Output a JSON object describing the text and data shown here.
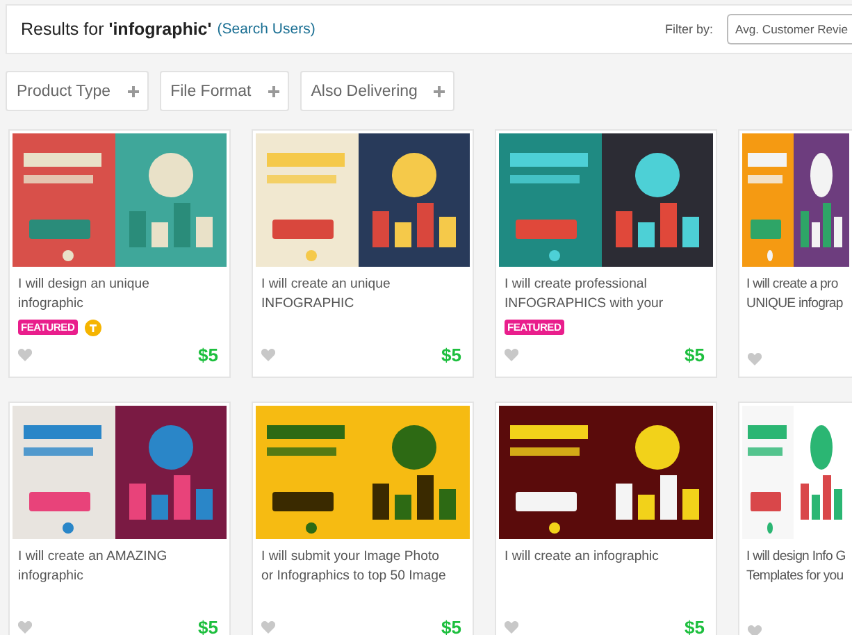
{
  "header": {
    "results_prefix": "Results for",
    "query": "'infographic'",
    "search_users": "(Search Users)",
    "filter_label": "Filter by:",
    "sort_value": "Avg. Customer Revie"
  },
  "filters": [
    {
      "label": "Product Type"
    },
    {
      "label": "File Format"
    },
    {
      "label": "Also Delivering"
    }
  ],
  "gigs": [
    {
      "title_lines": [
        "I will design an unique",
        "infographic"
      ],
      "badge": "FEATURED",
      "top_rated": true,
      "liked": false,
      "price": "$5"
    },
    {
      "title_lines": [
        "I will create an unique",
        "INFOGRAPHIC"
      ],
      "top_rated": false,
      "liked": false,
      "price": "$5"
    },
    {
      "title_lines": [
        "I will create professional",
        "INFOGRAPHICS with your"
      ],
      "badge": "FEATURED",
      "top_rated": false,
      "liked": false,
      "price": "$5"
    },
    {
      "title_lines": [
        "I will create a pro",
        "UNIQUE infograp"
      ],
      "top_rated": false,
      "liked": false
    },
    {
      "title_lines": [
        "I will create an AMAZING",
        "infographic"
      ],
      "top_rated": false,
      "liked": false,
      "price": "$5"
    },
    {
      "title_lines": [
        "I will submit your Image Photo",
        "or Infographics to top 50 Image"
      ],
      "top_rated": false,
      "liked": false,
      "price": "$5"
    },
    {
      "title_lines": [
        "I will create an infographic"
      ],
      "top_rated": false,
      "liked": false,
      "price": "$5"
    },
    {
      "title_lines": [
        "I will design Info G",
        "Templates for you"
      ],
      "top_rated": false,
      "liked": false
    }
  ]
}
